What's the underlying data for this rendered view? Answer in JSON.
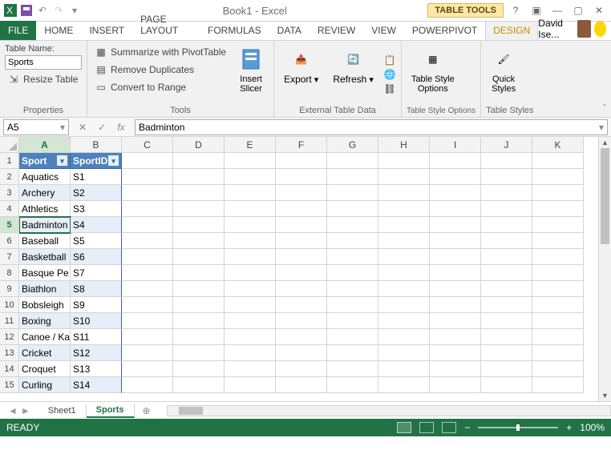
{
  "window_title": "Book1 - Excel",
  "table_tools": "TABLE TOOLS",
  "tabs": {
    "file": "FILE",
    "home": "HOME",
    "insert": "INSERT",
    "pagelayout": "PAGE LAYOUT",
    "formulas": "FORMULAS",
    "data": "DATA",
    "review": "REVIEW",
    "view": "VIEW",
    "powerpivot": "POWERPIVOT",
    "design": "DESIGN"
  },
  "user_name": "David Ise...",
  "ribbon": {
    "properties": {
      "label": "Properties",
      "table_name_label": "Table Name:",
      "table_name_value": "Sports",
      "resize": "Resize Table"
    },
    "tools": {
      "label": "Tools",
      "pivot": "Summarize with PivotTable",
      "dup": "Remove Duplicates",
      "range": "Convert to Range",
      "slicer": "Insert\nSlicer"
    },
    "external": {
      "label": "External Table Data",
      "export": "Export",
      "refresh": "Refresh"
    },
    "styleopts": {
      "label": "Table Style Options",
      "opts": "Table Style\nOptions"
    },
    "styles": {
      "label": "Table Styles",
      "quick": "Quick\nStyles"
    }
  },
  "namebox": "A5",
  "formula": "Badminton",
  "columns": [
    "A",
    "B",
    "C",
    "D",
    "E",
    "F",
    "G",
    "H",
    "I",
    "J",
    "K"
  ],
  "headers": {
    "a": "Sport",
    "b": "SportID"
  },
  "data_rows": [
    {
      "a": "Aquatics",
      "b": "S1"
    },
    {
      "a": "Archery",
      "b": "S2"
    },
    {
      "a": "Athletics",
      "b": "S3"
    },
    {
      "a": "Badminton",
      "b": "S4"
    },
    {
      "a": "Baseball",
      "b": "S5"
    },
    {
      "a": "Basketball",
      "b": "S6"
    },
    {
      "a": "Basque Pe",
      "b": "S7"
    },
    {
      "a": "Biathlon",
      "b": "S8"
    },
    {
      "a": "Bobsleigh",
      "b": "S9"
    },
    {
      "a": "Boxing",
      "b": "S10"
    },
    {
      "a": "Canoe / Ka",
      "b": "S11"
    },
    {
      "a": "Cricket",
      "b": "S12"
    },
    {
      "a": "Croquet",
      "b": "S13"
    },
    {
      "a": "Curling",
      "b": "S14"
    }
  ],
  "sheets": {
    "sheet1": "Sheet1",
    "sports": "Sports"
  },
  "status": "READY",
  "zoom": "100%"
}
